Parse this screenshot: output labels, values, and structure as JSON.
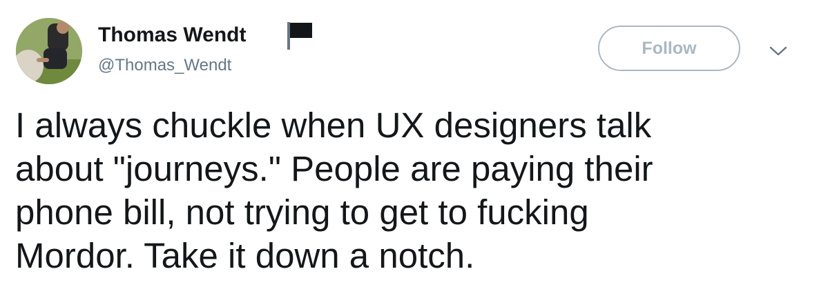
{
  "author": {
    "display_name": "Thomas Wendt",
    "handle": "@Thomas_Wendt",
    "name_icon": "black-flag-icon",
    "avatar_icon": "profile-photo-avatar"
  },
  "actions": {
    "follow_label": "Follow",
    "more_icon": "chevron-down-icon"
  },
  "tweet": {
    "lines": [
      "I always chuckle when UX designers talk",
      "about \"journeys.\" People are paying their",
      "phone bill, not trying to get to fucking",
      "Mordor. Take it down a notch."
    ]
  },
  "colors": {
    "text": "#14171a",
    "secondary": "#657786",
    "button_border": "#aab8c2"
  }
}
